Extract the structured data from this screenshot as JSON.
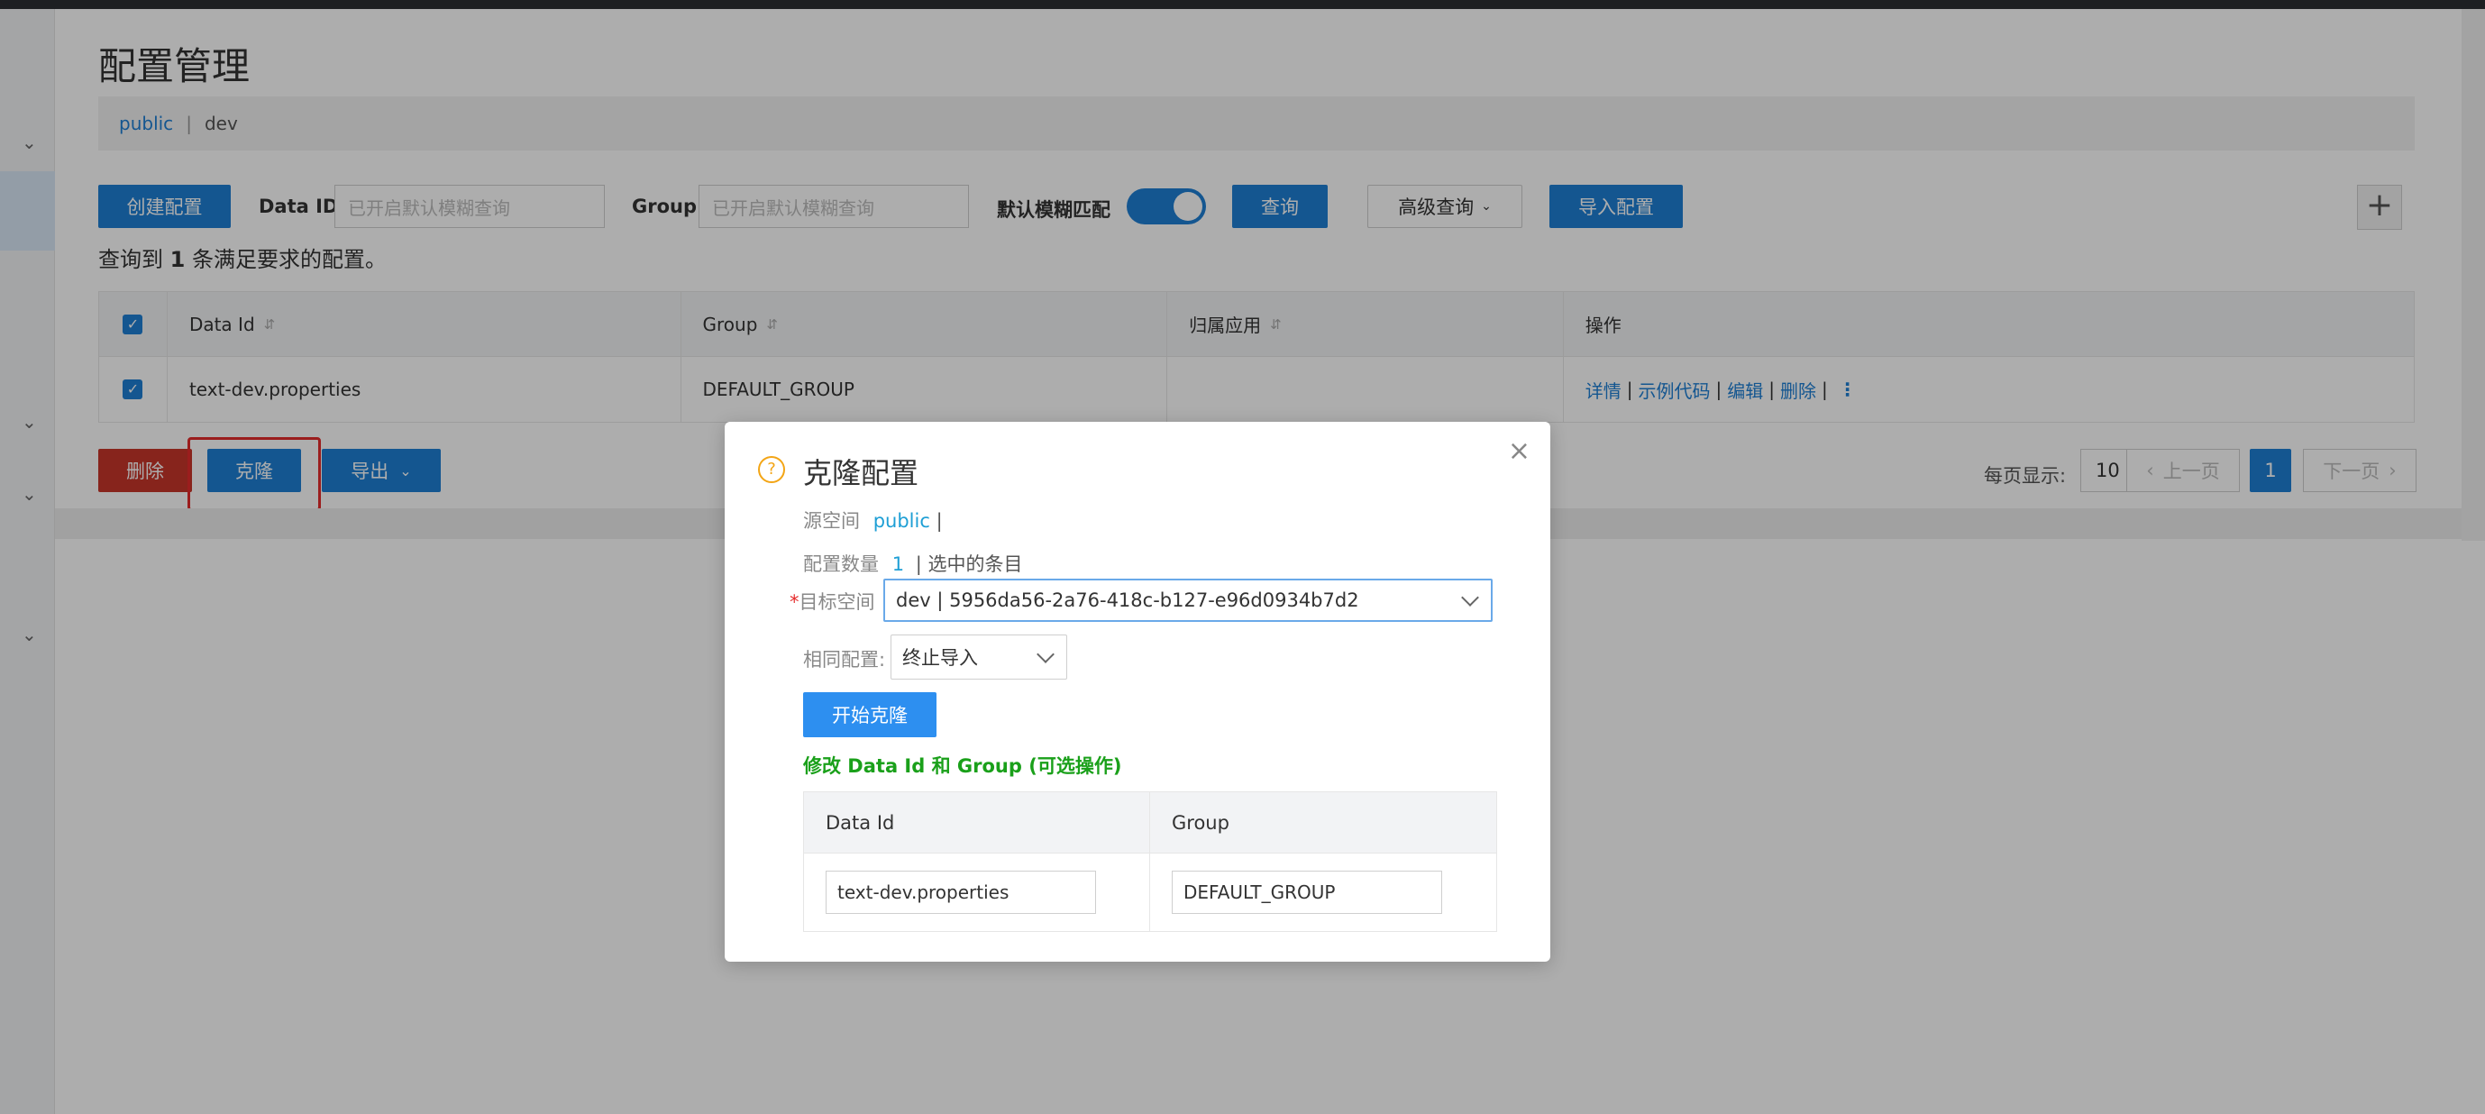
{
  "page": {
    "title": "配置管理",
    "breadcrumb": {
      "ns_public": "public",
      "separator": "|",
      "ns_dev": "dev"
    }
  },
  "toolbar": {
    "create_label": "创建配置",
    "dataid_label": "Data ID",
    "dataid_placeholder": "已开启默认模糊查询",
    "group_label": "Group",
    "group_placeholder": "已开启默认模糊查询",
    "fuzzy_label": "默认模糊匹配",
    "query_label": "查询",
    "advanced_label": "高级查询",
    "import_label": "导入配置",
    "plus_label": "+"
  },
  "result": {
    "prefix": "查询到",
    "count": "1",
    "suffix": "条满足要求的配置。"
  },
  "table": {
    "headers": [
      "Data Id",
      "Group",
      "归属应用",
      "操作"
    ],
    "rows": [
      {
        "data_id": "text-dev.properties",
        "group": "DEFAULT_GROUP",
        "app": "",
        "ops": [
          "详情",
          "示例代码",
          "编辑",
          "删除"
        ]
      }
    ]
  },
  "bottom": {
    "delete_label": "删除",
    "clone_label": "克隆",
    "export_label": "导出",
    "per_page_label": "每页显示:",
    "per_page_value": "10",
    "prev_label": "上一页",
    "current_page": "1",
    "next_label": "下一页"
  },
  "modal": {
    "title": "克隆配置",
    "source_label": "源空间",
    "source_value": "public",
    "source_sep": "|",
    "count_label": "配置数量",
    "count_value": "1",
    "count_suffix": "| 选中的条目",
    "target_required": "*",
    "target_label": "目标空间",
    "target_value": "dev | 5956da56-2a76-418c-b127-e96d0934b7d2",
    "same_label": "相同配置:",
    "same_value": "终止导入",
    "start_label": "开始克隆",
    "modify_title": "修改 Data Id 和 Group (可选操作)",
    "table_headers": [
      "Data Id",
      "Group"
    ],
    "row": {
      "data_id": "text-dev.properties",
      "group": "DEFAULT_GROUP"
    }
  },
  "colors": {
    "primary": "#1e7fd5",
    "danger": "#c8352a",
    "highlight": "#e52b2b",
    "green": "#1aa01a"
  }
}
